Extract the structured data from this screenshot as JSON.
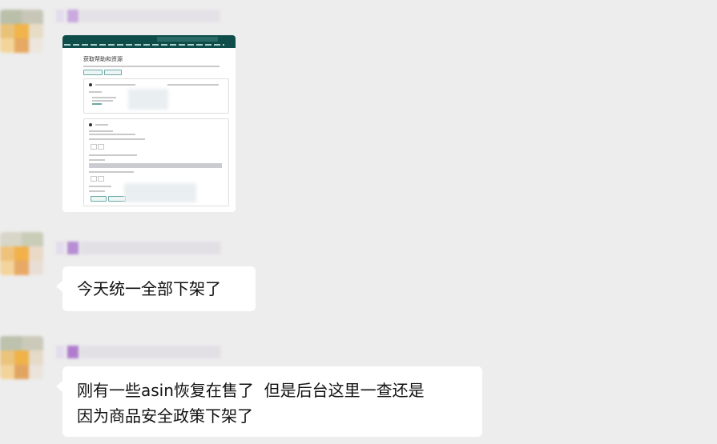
{
  "messages": [
    {
      "type": "image",
      "screenshot": {
        "title": "获取帮助和资源"
      }
    },
    {
      "type": "text",
      "text": "今天统一全部下架了"
    },
    {
      "type": "text",
      "lines": [
        "刚有一些asin恢复在售了  但是后台这里一查还是",
        "因为商品安全政策下架了"
      ]
    }
  ]
}
